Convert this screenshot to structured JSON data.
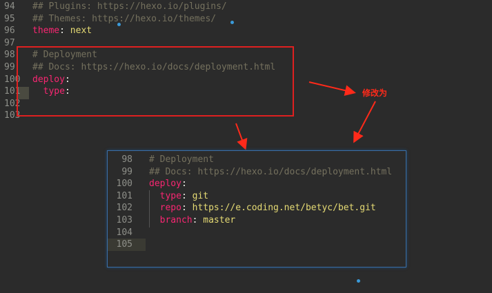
{
  "editor": {
    "lines": [
      {
        "num": "94",
        "parts": [
          {
            "t": "## Plugins: https://hexo.io/plugins/",
            "c": "comment"
          }
        ]
      },
      {
        "num": "95",
        "parts": [
          {
            "t": "## Themes: https://hexo.io/themes/",
            "c": "comment"
          }
        ]
      },
      {
        "num": "96",
        "parts": [
          {
            "t": "theme",
            "c": "key"
          },
          {
            "t": ": ",
            "c": "plain"
          },
          {
            "t": "next",
            "c": "val"
          }
        ]
      },
      {
        "num": "97",
        "parts": []
      },
      {
        "num": "98",
        "parts": [
          {
            "t": "# Deployment",
            "c": "comment"
          }
        ]
      },
      {
        "num": "99",
        "parts": [
          {
            "t": "## Docs: https://hexo.io/docs/deployment.html",
            "c": "comment"
          }
        ]
      },
      {
        "num": "100",
        "parts": [
          {
            "t": "deploy",
            "c": "key"
          },
          {
            "t": ":",
            "c": "plain"
          }
        ]
      },
      {
        "num": "101",
        "parts": [
          {
            "t": "  type",
            "c": "key"
          },
          {
            "t": ":",
            "c": "plain"
          }
        ]
      },
      {
        "num": "102",
        "parts": []
      },
      {
        "num": "103",
        "parts": []
      }
    ]
  },
  "annotation": {
    "label": "修改为",
    "color": "#ff2a1a"
  },
  "panel": {
    "lines": [
      {
        "num": "98",
        "parts": [
          {
            "t": "# Deployment",
            "c": "comment"
          }
        ]
      },
      {
        "num": "99",
        "parts": [
          {
            "t": "## Docs: https://hexo.io/docs/deployment.html",
            "c": "comment"
          }
        ]
      },
      {
        "num": "100",
        "parts": [
          {
            "t": "deploy",
            "c": "key"
          },
          {
            "t": ":",
            "c": "plain"
          }
        ]
      },
      {
        "num": "101",
        "parts": [
          {
            "t": "  type",
            "c": "key"
          },
          {
            "t": ": ",
            "c": "plain"
          },
          {
            "t": "git",
            "c": "val"
          }
        ]
      },
      {
        "num": "102",
        "parts": [
          {
            "t": "  repo",
            "c": "key"
          },
          {
            "t": ": ",
            "c": "plain"
          },
          {
            "t": "https://e.coding.net/betyc/bet.git",
            "c": "val"
          }
        ]
      },
      {
        "num": "103",
        "parts": [
          {
            "t": "  branch",
            "c": "key"
          },
          {
            "t": ": ",
            "c": "plain"
          },
          {
            "t": "master",
            "c": "val"
          }
        ]
      },
      {
        "num": "104",
        "parts": []
      },
      {
        "num": "105",
        "parts": []
      }
    ]
  },
  "colors": {
    "comment": "#75715e",
    "key": "#f92672",
    "value": "#e6db74",
    "highlight": "#e02020",
    "panel_border": "#3b6fa8"
  }
}
